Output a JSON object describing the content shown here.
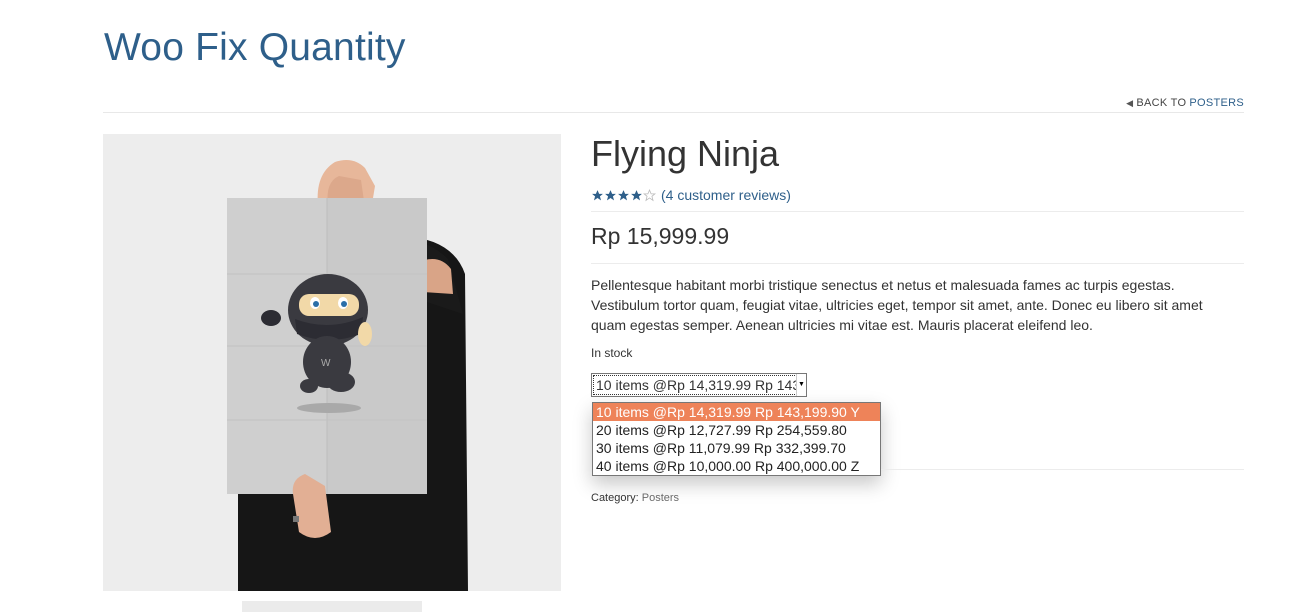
{
  "site": {
    "title": "Woo Fix Quantity"
  },
  "nav": {
    "back_prefix": "BACK TO",
    "back_category": "POSTERS"
  },
  "product": {
    "title": "Flying Ninja",
    "rating": 4,
    "rating_max": 5,
    "reviews_text": "(4 customer reviews)",
    "price": "Rp 15,999.99",
    "description": "Pellentesque habitant morbi tristique senectus et netus et malesuada fames ac turpis egestas. Vestibulum tortor quam, feugiat vitae, ultricies eget, tempor sit amet, ante. Donec eu libero sit amet quam egestas semper. Aenean ultricies mi vitae est. Mauris placerat eleifend leo.",
    "stock": "In stock",
    "quantity_select": {
      "selected_value": "10 items @Rp 14,319.99 Rp 143,199.90 Y",
      "options": [
        "10 items @Rp 14,319.99 Rp 143,199.90 Y",
        "20 items @Rp 12,727.99 Rp 254,559.80",
        "30 items @Rp 11,079.99 Rp 332,399.70",
        "40 items @Rp 10,000.00 Rp 400,000.00 Z"
      ]
    },
    "category_label": "Category:",
    "category_value": "Posters"
  },
  "colors": {
    "accent": "#2e5f8a",
    "selected_option": "#ee8359"
  }
}
